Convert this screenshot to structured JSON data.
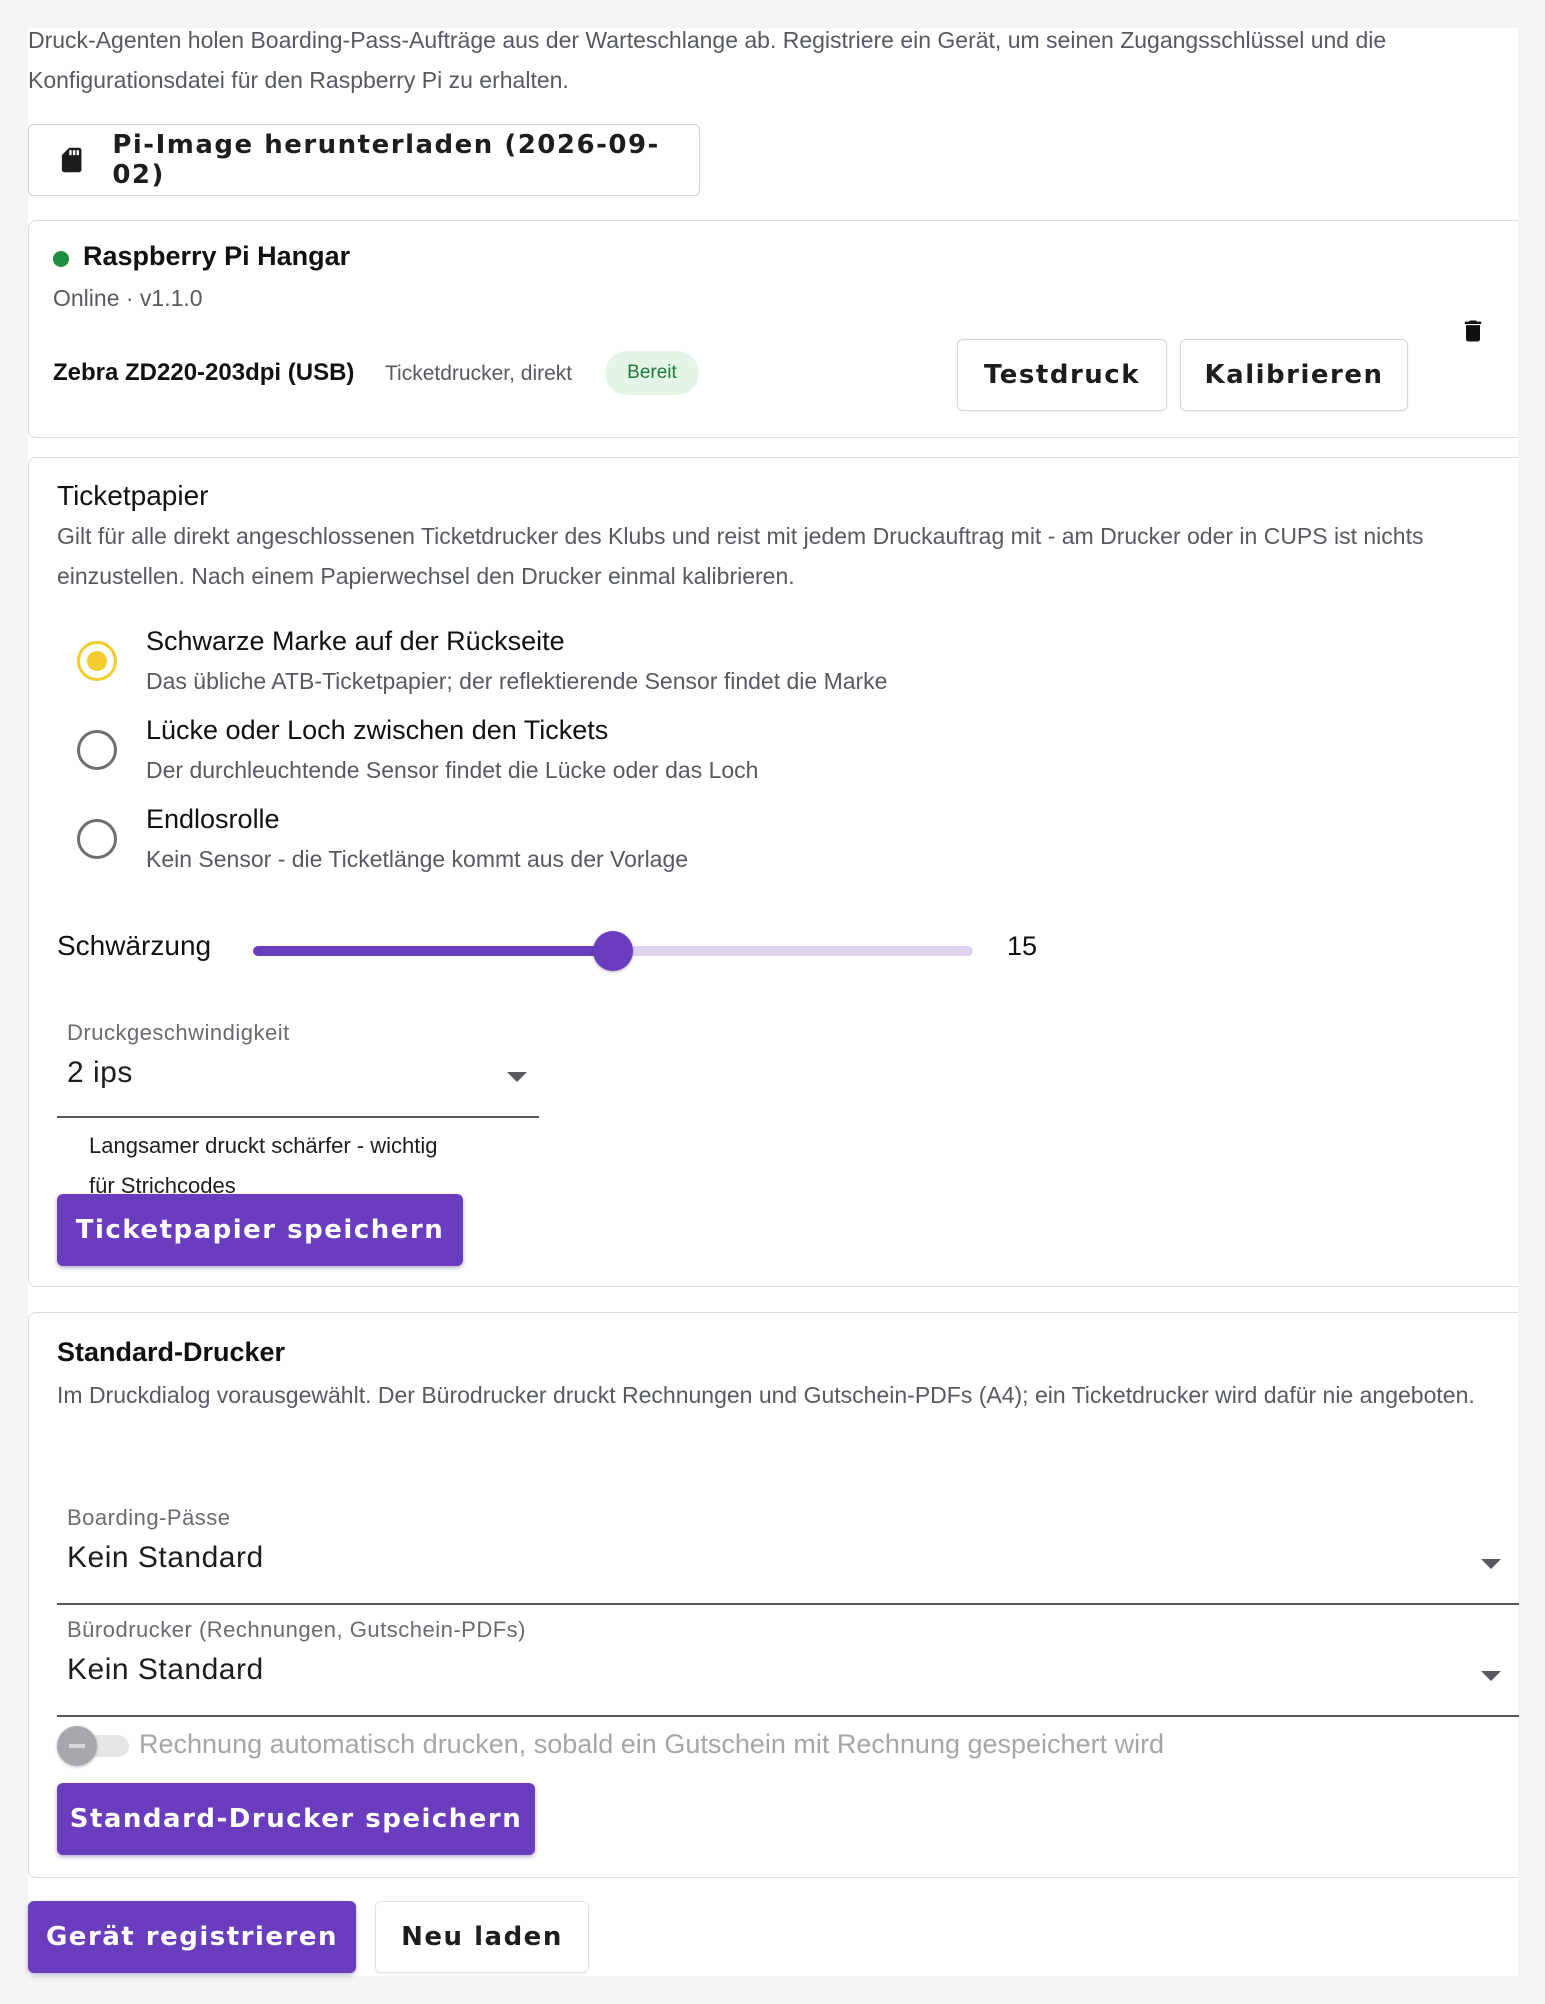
{
  "intro": {
    "text": "Druck-Agenten holen Boarding-Pass-Aufträge aus der Warteschlange ab. Registriere ein Gerät, um seinen Zugangsschlüssel und die Konfigurationsdatei für den Raspberry Pi zu erhalten."
  },
  "download": {
    "label": "Pi-Image herunterladen (2026-09-02)",
    "icon": "sd-card-icon"
  },
  "device": {
    "name": "Raspberry Pi Hangar",
    "status_color": "#1e8e3e",
    "status_line": "Online · v1.1.0",
    "printer": {
      "name": "Zebra ZD220-203dpi (USB)",
      "type": "Ticketdrucker, direkt",
      "badge": "Bereit",
      "test_label": "Testdruck",
      "calibrate_label": "Kalibrieren"
    },
    "delete_icon": "trash-icon"
  },
  "ticketpaper": {
    "title": "Ticketpapier",
    "description": "Gilt für alle direkt angeschlossenen Ticketdrucker des Klubs und reist mit jedem Druckauftrag mit - am Drucker oder in CUPS ist nichts einzustellen. Nach einem Papierwechsel den Drucker einmal kalibrieren.",
    "options": [
      {
        "title": "Schwarze Marke auf der Rückseite",
        "subtitle": "Das übliche ATB-Ticketpapier; der reflektierende Sensor findet die Marke",
        "selected": true
      },
      {
        "title": "Lücke oder Loch zwischen den Tickets",
        "subtitle": "Der durchleuchtende Sensor findet die Lücke oder das Loch",
        "selected": false
      },
      {
        "title": "Endlosrolle",
        "subtitle": "Kein Sensor - die Ticketlänge kommt aus der Vorlage",
        "selected": false
      }
    ],
    "darkness": {
      "label": "Schwärzung",
      "value": "15",
      "min": 0,
      "max": 30,
      "buffer_fraction": 0.5
    },
    "speed": {
      "label": "Druckgeschwindigkeit",
      "value": "2 ips",
      "hint": "Langsamer druckt schärfer - wichtig für Strichcodes"
    },
    "save_label": "Ticketpapier speichern"
  },
  "default_printer": {
    "title": "Standard-Drucker",
    "description": "Im Druckdialog vorausgewählt. Der Bürodrucker druckt Rechnungen und Gutschein-PDFs (A4); ein Ticketdrucker wird dafür nie angeboten.",
    "boarding": {
      "label": "Boarding-Pässe",
      "value": "Kein Standard"
    },
    "office": {
      "label": "Bürodrucker (Rechnungen, Gutschein-PDFs)",
      "value": "Kein Standard"
    },
    "auto_print": {
      "label": "Rechnung automatisch drucken, sobald ein Gutschein mit Rechnung gespeichert wird",
      "enabled": false
    },
    "save_label": "Standard-Drucker speichern"
  },
  "footer": {
    "register_label": "Gerät registrieren",
    "reload_label": "Neu laden"
  },
  "colors": {
    "accent": "#6a3dbf",
    "radio_selected": "#f5cc2e",
    "badge_bg": "#e4f4e7",
    "badge_text": "#1e7b34"
  }
}
